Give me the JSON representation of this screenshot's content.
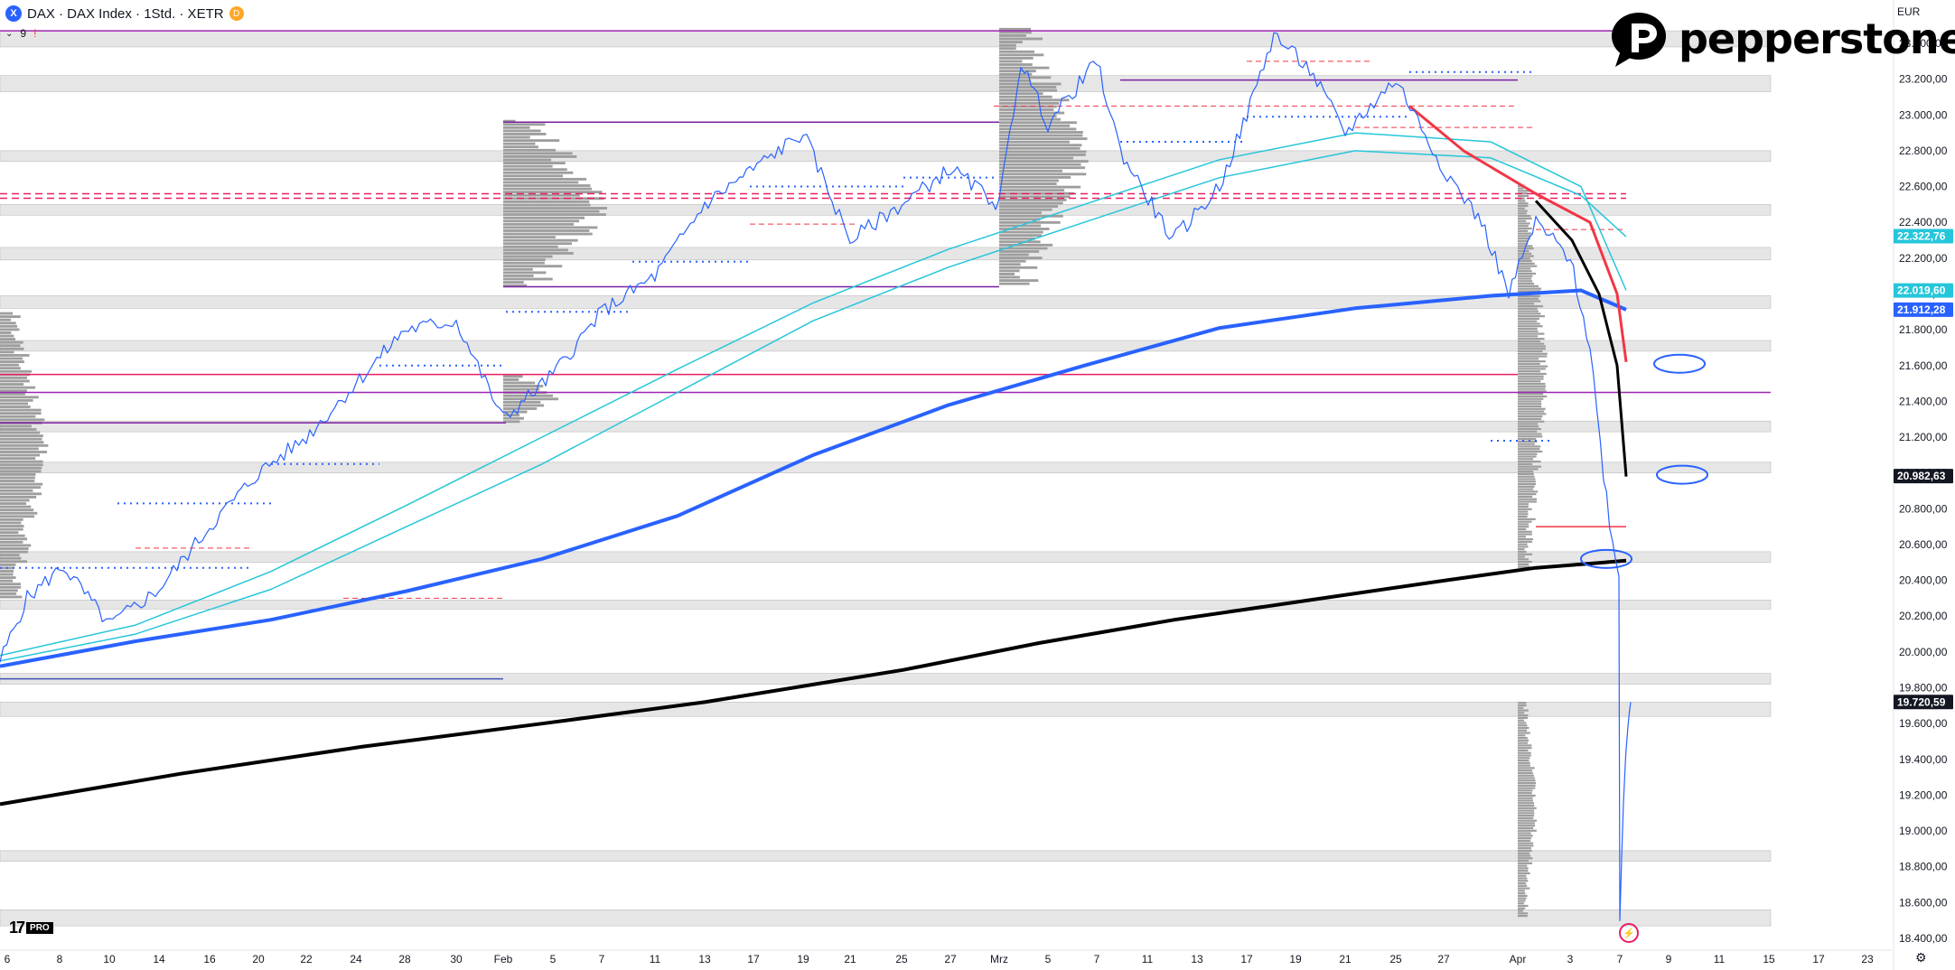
{
  "header": {
    "symbol_icon": "X",
    "title": "DAX · DAX Index · 1Std. · XETR",
    "badge": "D",
    "sub_chevron": "⌄",
    "sub_count": "9",
    "sub_flag": "!"
  },
  "currency": "EUR",
  "brand": {
    "name": "pepperstone",
    "color": "#000000"
  },
  "tv_badge": {
    "mark": "17",
    "pro": "PRO"
  },
  "icons": {
    "settings": "gear-icon",
    "flash": "lightning-icon"
  },
  "colors": {
    "price": "#2962ff",
    "ema_fast": "#26c6da",
    "ema_blue": "#2962ff",
    "sma_black": "#000000",
    "vwap_red": "#f23645",
    "magenta": "#e91e63",
    "violet": "#7b1fa2",
    "zone": "#e6e6e6"
  },
  "chart_data": {
    "type": "line",
    "title": "DAX · DAX Index · 1Std. · XETR",
    "ylim": [
      18400,
      23600
    ],
    "y_ticks": [
      "23.400,00",
      "23.200,00",
      "23.000,00",
      "22.800,00",
      "22.600,00",
      "22.400,00",
      "22.200,00",
      "22.000,00",
      "21.800,00",
      "21.600,00",
      "21.400,00",
      "21.200,00",
      "21.000,00",
      "20.800,00",
      "20.600,00",
      "20.400,00",
      "20.200,00",
      "20.000,00",
      "19.800,00",
      "19.600,00",
      "19.400,00",
      "19.200,00",
      "19.000,00",
      "18.800,00",
      "18.600,00",
      "18.400,00"
    ],
    "x_ticks": [
      "6",
      "8",
      "10",
      "14",
      "16",
      "20",
      "22",
      "24",
      "28",
      "30",
      "Feb",
      "5",
      "7",
      "11",
      "13",
      "17",
      "19",
      "21",
      "25",
      "27",
      "Mrz",
      "5",
      "7",
      "11",
      "13",
      "17",
      "19",
      "21",
      "25",
      "27",
      "Apr",
      "3",
      "7",
      "9",
      "11",
      "15",
      "17",
      "23"
    ],
    "price_labels": [
      {
        "value": 22322.76,
        "text": "22.322,76",
        "color": "#26c6da"
      },
      {
        "value": 22019.6,
        "text": "22.019,60",
        "color": "#26c6da"
      },
      {
        "value": 21912.28,
        "text": "21.912,28",
        "color": "#2962ff"
      },
      {
        "value": 20982.63,
        "text": "20.982,63",
        "color": "#131722"
      },
      {
        "value": 19720.59,
        "text": "19.720,59",
        "color": "#131722"
      }
    ],
    "zones": [
      [
        23380,
        23470
      ],
      [
        23130,
        23220
      ],
      [
        22740,
        22800
      ],
      [
        22440,
        22500
      ],
      [
        22190,
        22260
      ],
      [
        21920,
        21990
      ],
      [
        21680,
        21740
      ],
      [
        21230,
        21290
      ],
      [
        21000,
        21060
      ],
      [
        20500,
        20560
      ],
      [
        20240,
        20290
      ],
      [
        19820,
        19880
      ],
      [
        19640,
        19720
      ],
      [
        18830,
        18890
      ],
      [
        18470,
        18560
      ]
    ],
    "hlines": [
      {
        "y": 23470,
        "x0": 0,
        "x1": 1800,
        "color": "#9c27b0"
      },
      {
        "y": 23195,
        "x0": 1240,
        "x1": 1680,
        "color": "#7b1fa2"
      },
      {
        "y": 22960,
        "x0": 557,
        "x1": 1106,
        "color": "#7b1fa2"
      },
      {
        "y": 22040,
        "x0": 557,
        "x1": 1106,
        "color": "#7b1fa2"
      },
      {
        "y": 22560,
        "x0": 0,
        "x1": 1800,
        "color": "#e91e63",
        "dash": true
      },
      {
        "y": 22535,
        "x0": 0,
        "x1": 1800,
        "color": "#e91e63",
        "dash": true
      },
      {
        "y": 21550,
        "x0": 0,
        "x1": 1680,
        "color": "#e91e63"
      },
      {
        "y": 21450,
        "x0": 0,
        "x1": 1960,
        "color": "#9c27b0"
      },
      {
        "y": 21280,
        "x0": 0,
        "x1": 560,
        "color": "#7b1fa2"
      },
      {
        "y": 20700,
        "x0": 1700,
        "x1": 1800,
        "color": "#f23645"
      },
      {
        "y": 19850,
        "x0": 0,
        "x1": 557,
        "color": "#3f51b5"
      }
    ],
    "series": [
      {
        "role": "price",
        "color": "#2962ff",
        "x": [
          "6",
          "10",
          "14",
          "20",
          "24",
          "30",
          "Feb",
          "7",
          "13",
          "19",
          "25",
          "Mrz",
          "7",
          "13",
          "19",
          "25",
          "Apr",
          "3",
          "7"
        ],
        "values": [
          19950,
          20450,
          20100,
          21000,
          21500,
          21850,
          21300,
          21900,
          22600,
          22900,
          22400,
          23300,
          22400,
          22650,
          23450,
          22900,
          22300,
          21500,
          19720
        ]
      },
      {
        "role": "ema-fast",
        "color": "#26c6da",
        "values": [
          19950,
          20200,
          20400,
          20800,
          21200,
          21600,
          22000,
          22200,
          22450,
          22700,
          22850,
          22800,
          22500,
          22200
        ]
      },
      {
        "role": "ema-slow",
        "color": "#2962ff",
        "values": [
          19930,
          20150,
          20250,
          20500,
          20700,
          21000,
          21300,
          21600,
          21800,
          21950,
          22020,
          22020,
          21912
        ]
      },
      {
        "role": "sma-long",
        "color": "#000000",
        "values": [
          19150,
          19350,
          19560,
          19760,
          20000,
          20200,
          20350,
          20450,
          20510
        ]
      },
      {
        "role": "vwap",
        "color": "#f23645",
        "values": [
          23000,
          22500,
          22300,
          21620
        ]
      },
      {
        "role": "vwap-2",
        "color": "#000000",
        "values": [
          22500,
          22350,
          21600,
          20980
        ]
      }
    ],
    "grid": false,
    "legend": "none"
  }
}
